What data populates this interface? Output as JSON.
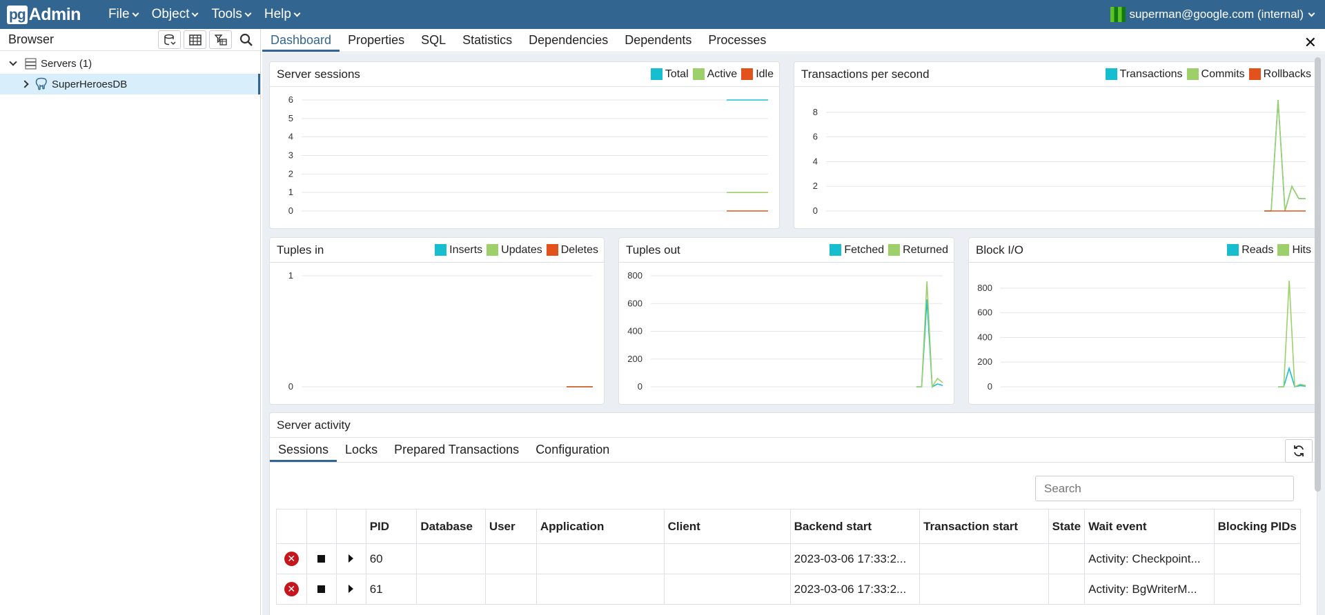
{
  "app": {
    "logo_pg": "pg",
    "logo_admin": "Admin"
  },
  "menu": [
    "File",
    "Object",
    "Tools",
    "Help"
  ],
  "user": {
    "label": "superman@google.com (internal)"
  },
  "browser": {
    "title": "Browser",
    "tree": [
      {
        "label": "Servers (1)",
        "expanded": true
      },
      {
        "label": "SuperHeroesDB",
        "selected": true
      }
    ]
  },
  "tabs": [
    "Dashboard",
    "Properties",
    "SQL",
    "Statistics",
    "Dependencies",
    "Dependents",
    "Processes"
  ],
  "active_tab": "Dashboard",
  "colors": {
    "navbar": "#326690",
    "teal": "#17bed0",
    "green": "#9dcf6a",
    "orange": "#e2521c"
  },
  "cards": {
    "sessions": {
      "title": "Server sessions",
      "legend": [
        "Total",
        "Active",
        "Idle"
      ]
    },
    "tps": {
      "title": "Transactions per second",
      "legend": [
        "Transactions",
        "Commits",
        "Rollbacks"
      ]
    },
    "tuples_in": {
      "title": "Tuples in",
      "legend": [
        "Inserts",
        "Updates",
        "Deletes"
      ]
    },
    "tuples_out": {
      "title": "Tuples out",
      "legend": [
        "Fetched",
        "Returned"
      ]
    },
    "block_io": {
      "title": "Block I/O",
      "legend": [
        "Reads",
        "Hits"
      ]
    }
  },
  "chart_data": [
    {
      "type": "line",
      "title": "Server sessions",
      "yticks": [
        0,
        1,
        2,
        3,
        4,
        5,
        6
      ],
      "ylim": [
        0,
        6
      ],
      "series": [
        {
          "name": "Total",
          "color": "#17bed0",
          "values": [
            6,
            6,
            6,
            6,
            6
          ]
        },
        {
          "name": "Active",
          "color": "#9dcf6a",
          "values": [
            1,
            1,
            1,
            1,
            1
          ]
        },
        {
          "name": "Idle",
          "color": "#e2521c",
          "values": [
            0,
            0,
            0,
            0,
            0
          ]
        }
      ]
    },
    {
      "type": "line",
      "title": "Transactions per second",
      "yticks": [
        0,
        2,
        4,
        6,
        8
      ],
      "ylim": [
        0,
        9
      ],
      "series": [
        {
          "name": "Transactions",
          "color": "#17bed0",
          "values": [
            0,
            0,
            9,
            0,
            2,
            1,
            1
          ]
        },
        {
          "name": "Commits",
          "color": "#9dcf6a",
          "values": [
            0,
            0,
            9,
            0,
            2,
            1,
            1
          ]
        },
        {
          "name": "Rollbacks",
          "color": "#e2521c",
          "values": [
            0,
            0,
            0,
            0,
            0,
            0,
            0
          ]
        }
      ]
    },
    {
      "type": "line",
      "title": "Tuples in",
      "yticks": [
        0,
        1
      ],
      "ylim": [
        0,
        1
      ],
      "series": [
        {
          "name": "Inserts",
          "color": "#17bed0",
          "values": [
            0,
            0,
            0
          ]
        },
        {
          "name": "Updates",
          "color": "#9dcf6a",
          "values": [
            0,
            0,
            0
          ]
        },
        {
          "name": "Deletes",
          "color": "#e2521c",
          "values": [
            0,
            0,
            0
          ]
        }
      ]
    },
    {
      "type": "line",
      "title": "Tuples out",
      "yticks": [
        0,
        200,
        400,
        600,
        800
      ],
      "ylim": [
        0,
        800
      ],
      "series": [
        {
          "name": "Fetched",
          "color": "#17bed0",
          "values": [
            0,
            0,
            630,
            0,
            20,
            10
          ]
        },
        {
          "name": "Returned",
          "color": "#9dcf6a",
          "values": [
            0,
            0,
            760,
            0,
            60,
            30
          ]
        }
      ]
    },
    {
      "type": "line",
      "title": "Block I/O",
      "yticks": [
        0,
        200,
        400,
        600,
        800
      ],
      "ylim": [
        0,
        900
      ],
      "series": [
        {
          "name": "Reads",
          "color": "#17bed0",
          "values": [
            0,
            0,
            150,
            0,
            10,
            5
          ]
        },
        {
          "name": "Hits",
          "color": "#9dcf6a",
          "values": [
            0,
            0,
            860,
            0,
            20,
            10
          ]
        }
      ]
    }
  ],
  "activity": {
    "title": "Server activity",
    "tabs": [
      "Sessions",
      "Locks",
      "Prepared Transactions",
      "Configuration"
    ],
    "search_placeholder": "Search",
    "columns": [
      "PID",
      "Database",
      "User",
      "Application",
      "Client",
      "Backend start",
      "Transaction start",
      "State",
      "Wait event",
      "Blocking PIDs"
    ],
    "rows": [
      {
        "pid": "60",
        "database": "",
        "user": "",
        "application": "",
        "client": "",
        "backend_start": "2023-03-06 17:33:2...",
        "transaction_start": "",
        "state": "",
        "wait_event": "Activity: Checkpoint...",
        "blocking": ""
      },
      {
        "pid": "61",
        "database": "",
        "user": "",
        "application": "",
        "client": "",
        "backend_start": "2023-03-06 17:33:2...",
        "transaction_start": "",
        "state": "",
        "wait_event": "Activity: BgWriterM...",
        "blocking": ""
      }
    ]
  }
}
